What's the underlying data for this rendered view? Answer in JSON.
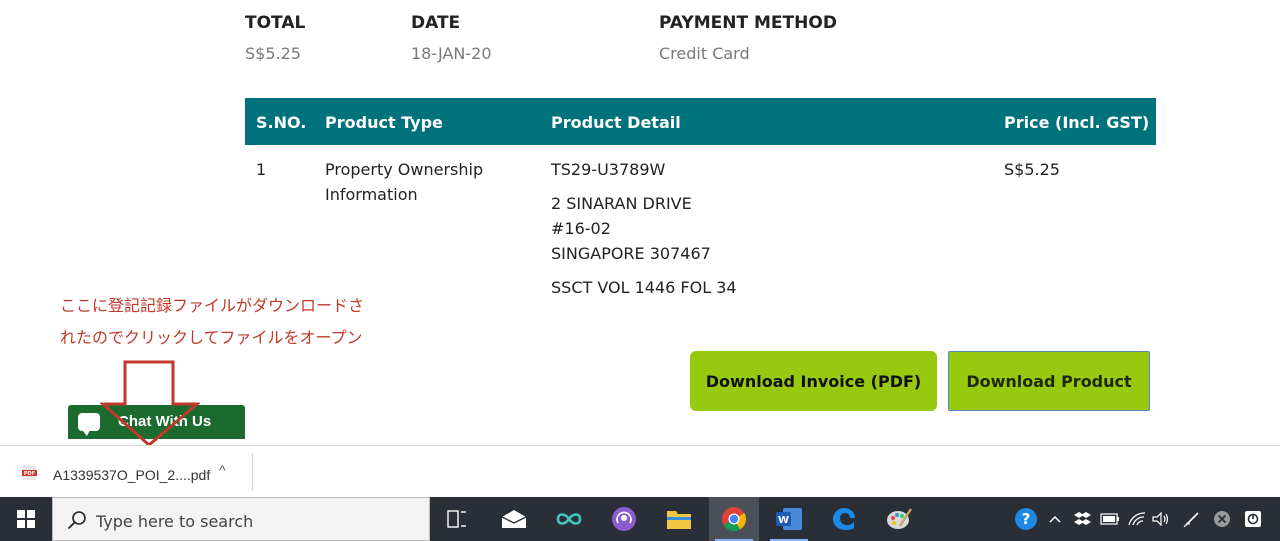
{
  "summary": {
    "total_label": "TOTAL",
    "total_value": "S$5.25",
    "date_label": "DATE",
    "date_value": "18-JAN-20",
    "payment_label": "PAYMENT METHOD",
    "payment_value": "Credit Card"
  },
  "table": {
    "headers": [
      "S.NO.",
      "Product Type",
      "Product Detail",
      "Price (Incl. GST)"
    ],
    "rows": [
      {
        "sno": "1",
        "type_line1": "Property Ownership",
        "type_line2": "Information",
        "detail_code": "TS29-U3789W",
        "detail_addr1": "2 SINARAN DRIVE",
        "detail_addr2": "#16-02",
        "detail_addr3": "SINGAPORE 307467",
        "detail_vol": "SSCT VOL 1446 FOL 34",
        "price": "S$5.25"
      }
    ]
  },
  "buttons": {
    "invoice": "Download Invoice (PDF)",
    "product": "Download Product"
  },
  "annotation": {
    "line1": "ここに登記記録ファイルがダウンロードさ",
    "line2": "れたのでクリックしてファイルをオープン"
  },
  "chat": {
    "label": "Chat With Us"
  },
  "download_bar": {
    "filename": "A1339537O_POI_2....pdf",
    "chevron": "^"
  },
  "taskbar": {
    "search_placeholder": "Type here to search",
    "apps": [
      "task-view",
      "mail",
      "infinity",
      "podcast",
      "file-explorer",
      "chrome",
      "word",
      "edge",
      "paint"
    ]
  },
  "colors": {
    "table_header": "#00727c",
    "button_green": "#97c90f",
    "chat_green": "#1b6b2f",
    "annotation_red": "#c0392b",
    "taskbar": "#2a2e36"
  }
}
